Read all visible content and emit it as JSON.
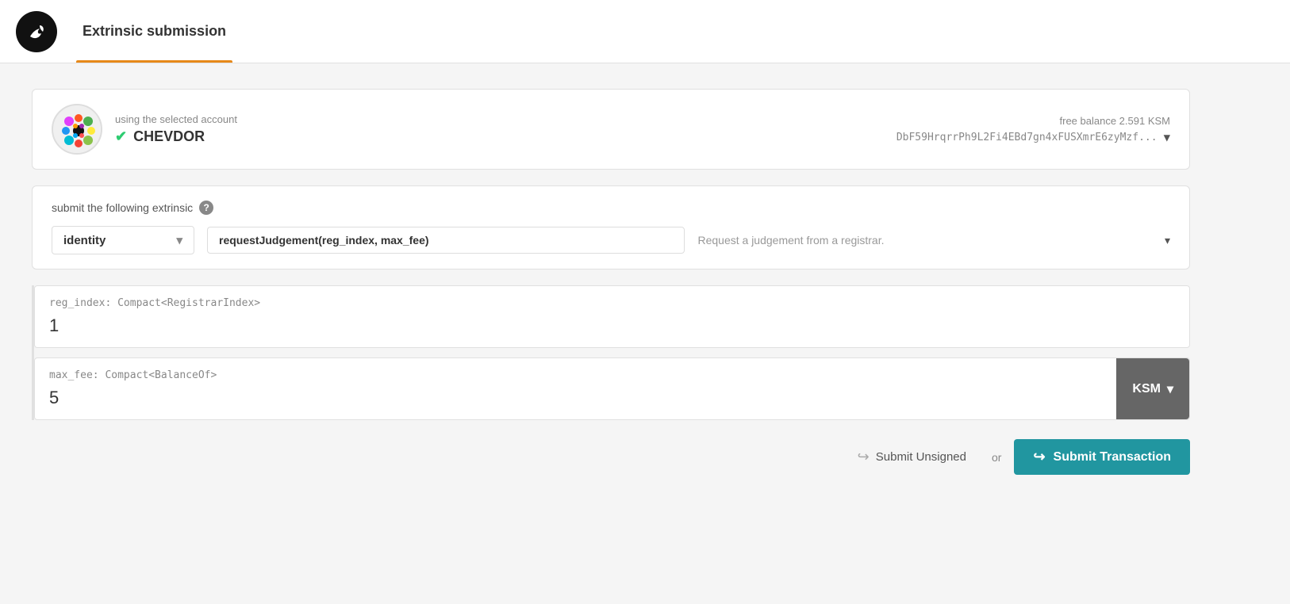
{
  "header": {
    "logo_alt": "Polkadot bird logo",
    "tab_label": "Extrinsic submission",
    "tab_active": true
  },
  "account": {
    "label": "using the selected account",
    "name": "CHEVDOR",
    "verified": true,
    "balance_label": "free balance",
    "balance_value": "2.591",
    "balance_currency": "KSM",
    "address": "DbF59HrqrrPh9L2Fi4EBd7gn4xFUSXmrE6zyMzf...",
    "dropdown_arrow": "▼"
  },
  "extrinsic": {
    "label": "submit the following extrinsic",
    "help_text": "?",
    "module": "identity",
    "method": "requestJudgement(reg_index, max_fee)",
    "method_description": "Request a judgement from a registrar.",
    "module_arrow": "▾",
    "method_arrow": "▾"
  },
  "params": [
    {
      "type": "reg_index: Compact<RegistrarIndex>",
      "value": "1",
      "has_ksm": false
    },
    {
      "type": "max_fee: Compact<BalanceOf>",
      "value": "5",
      "has_ksm": true,
      "ksm_label": "KSM",
      "ksm_arrow": "▾"
    }
  ],
  "actions": {
    "unsigned_arrow": "↪",
    "unsigned_label": "Submit Unsigned",
    "or_label": "or",
    "submit_arrow": "↪",
    "submit_label": "Submit Transaction"
  }
}
